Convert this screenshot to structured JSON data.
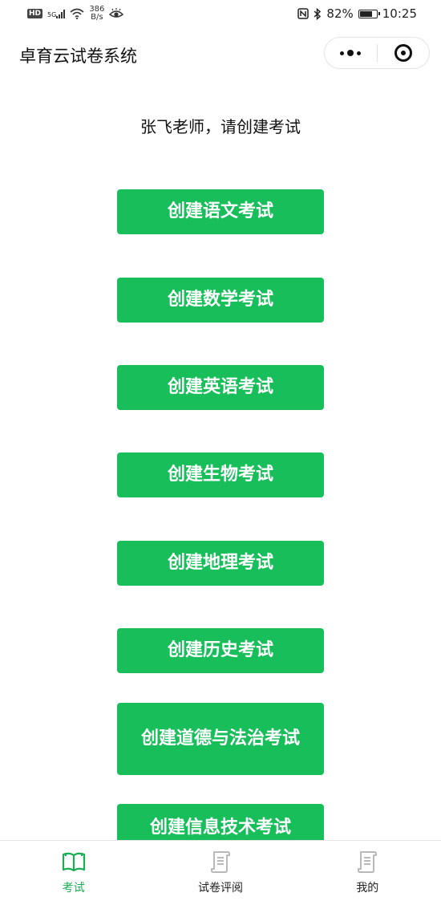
{
  "status_bar": {
    "hd": "HD",
    "signal": "5G",
    "speed_value": "386",
    "speed_unit": "B/s",
    "battery_text": "82%",
    "battery_level": 0.82,
    "time": "10:25"
  },
  "nav": {
    "title": "卓育云试卷系统"
  },
  "greeting": "张飞老师，请创建考试",
  "buttons": [
    "创建语文考试",
    "创建数学考试",
    "创建英语考试",
    "创建生物考试",
    "创建地理考试",
    "创建历史考试",
    "创建道德与法治考试",
    "创建信息技术考试"
  ],
  "tabs": [
    {
      "label": "考试",
      "icon": "open-book-icon",
      "active": true
    },
    {
      "label": "试卷评阅",
      "icon": "scroll-document-icon",
      "active": false
    },
    {
      "label": "我的",
      "icon": "scroll-document-icon",
      "active": false
    }
  ],
  "colors": {
    "accent": "#17be5a",
    "tab_active": "#1aad52",
    "tab_inactive_icon": "#b9b9b9"
  }
}
